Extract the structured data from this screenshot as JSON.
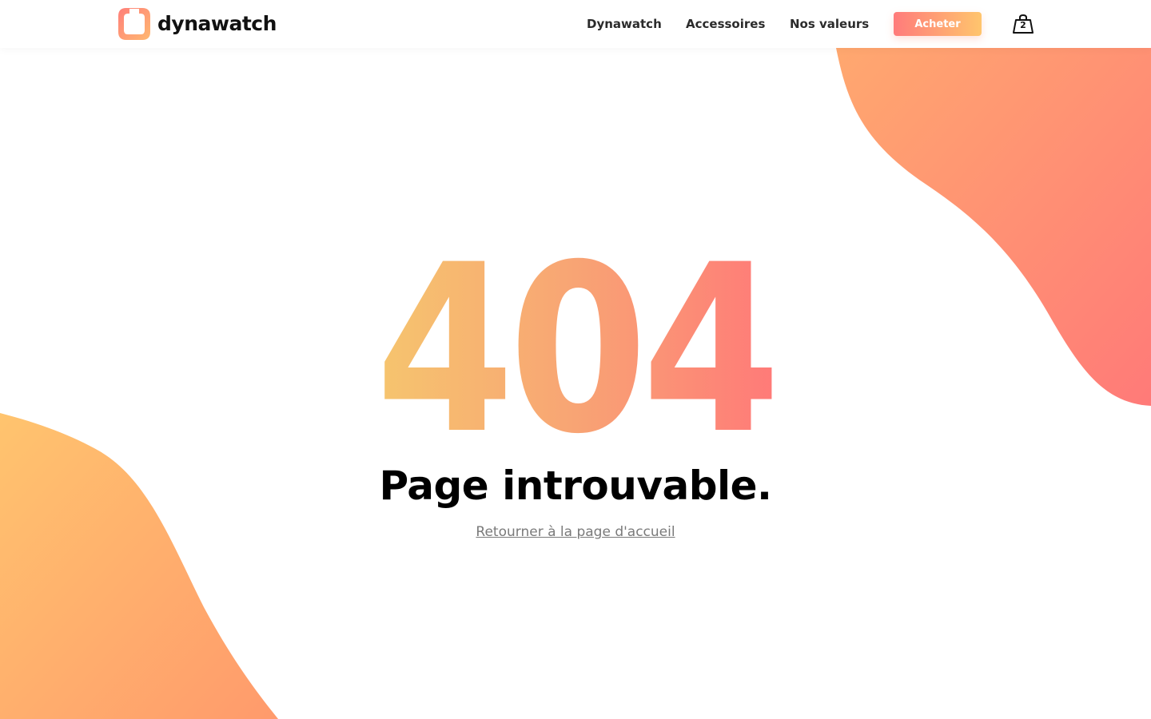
{
  "brand": {
    "name": "dynawatch",
    "logo_icon": "watch-outline-icon"
  },
  "nav": {
    "items": [
      {
        "label": "Dynawatch"
      },
      {
        "label": "Accessoires"
      },
      {
        "label": "Nos valeurs"
      }
    ],
    "buy_label": "Acheter",
    "cart_icon": "shopping-bag-icon",
    "cart_count": "2"
  },
  "error": {
    "code": "404",
    "title": "Page introuvable.",
    "home_link": "Retourner à la page d'accueil"
  },
  "colors": {
    "gradient_warm_yellow": "#f9c56e",
    "gradient_coral": "#ff7b7b",
    "gradient_orange": "#ffa36e",
    "text_dark": "#111111",
    "link_gray": "#7a7a7a"
  }
}
